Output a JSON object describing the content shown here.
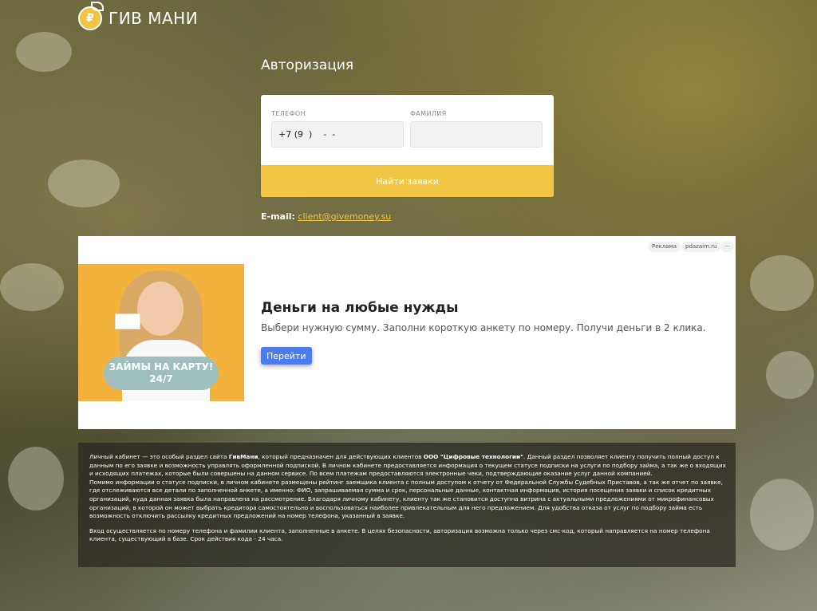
{
  "brand": {
    "name": "ГИВ МАНИ",
    "logo_symbol": "₽",
    "accent": "#f3c646"
  },
  "auth": {
    "title": "Авторизация",
    "phone_label": "ТЕЛЕФОН",
    "phone_value": "+7 (9  )    -  -",
    "surname_label": "ФАМИЛИЯ",
    "surname_value": "",
    "submit_label": "Найти заявки"
  },
  "contact": {
    "email_label": "E-mail:",
    "email": "client@givemoney.su"
  },
  "ad": {
    "tag_ad": "Реклама",
    "tag_domain": "pdazaim.ru",
    "tag_more": "···",
    "banner_line1": "ЗАЙМЫ НА КАРТУ!",
    "banner_line2": "24/7",
    "title": "Деньги на любые нужды",
    "subtitle": "Выбери нужную сумму. Заполни короткую анкету по номеру. Получи деньги в 2 клика.",
    "button_label": "Перейти",
    "button_color": "#4b7bf0"
  },
  "info": {
    "p1_a": "Личный кабинет — это особый раздел сайта ",
    "p1_brand": "ГивМани",
    "p1_b": ", который предназначен для действующих клиентов ",
    "p1_company": "ООО \"Цифровые технологии\"",
    "p1_c": ". Данный раздел позволяет клиенту получить полный доступ к данным по его заявке и возможность управлять оформленной подпиской. В личном кабинете предоставляется информация о текущем статусе подписки на услуги по подбору займа, а так же о входящих и исходящих платежах, которые были совершены на данном сервисе. По всем платежам предоставляются электронные чеки, подтверждающие оказание услуг данной компанией.",
    "p1_d": "Помимо информации о статусе подписки, в личном кабинете размещены рейтинг заемщика клиента с полным доступом к отчету от Федеральной Службы Судебных Приставов, а так же отчет по заявке, где отслеживаются все детали по заполненной анкете, а именно: ФИО, запрашиваемая сумма и срок, персональные данные, контактная информация, история посещения заявки и список кредитных организаций, куда данная заявка была направлена на рассмотрение. Благодаря личному кабинету, клиенту так же становится доступна витрина с актуальными предложениями от микрофинансовых организаций, в которой он может выбрать кредитора самостоятельно и воспользоваться наиболее привлекательным для него предложением. Для удобства отказа от услуг по подбору займа есть возможность отключить рассылку кредитных предложений на номер телефона, указанный в заявке.",
    "p2": "Вход осуществляется по номеру телефона и фамилии клиента, заполненные в анкете. В целях безопасности, авторизация возможна только через смс-код, который направляется на номер телефона клиента, существующий в базе. Срок действия кода - 24 часа."
  }
}
